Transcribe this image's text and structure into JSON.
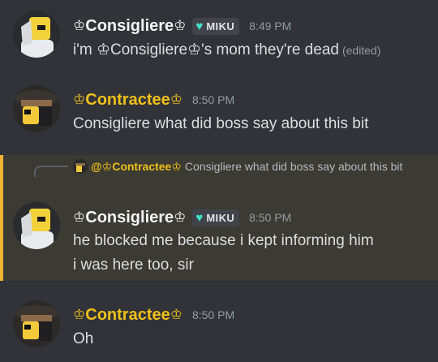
{
  "messages": [
    {
      "author": "Consigliere",
      "crown": "♔",
      "tag": "MIKU",
      "tag_icon": "heart-icon",
      "time": "8:49 PM",
      "text": "i'm ♔Consigliere♔'s mom they're dead",
      "edited": "(edited)"
    },
    {
      "author": "Contractee",
      "crown": "♔",
      "time": "8:50 PM",
      "text": "Consigliere what did boss say about this bit"
    },
    {
      "reply_to": {
        "mention": "@♔Contractee♔",
        "preview": "Consigliere what did boss say about this bit"
      },
      "author": "Consigliere",
      "crown": "♔",
      "tag": "MIKU",
      "tag_icon": "heart-icon",
      "time": "8:50 PM",
      "line1": "he blocked me because i kept informing him",
      "line2": "i was here too, sir"
    },
    {
      "author": "Contractee",
      "crown": "♔",
      "time": "8:50 PM",
      "text": "Oh"
    }
  ],
  "colors": {
    "background": "#313338",
    "highlight": "#3b3a33",
    "highlight_border": "#f0b232",
    "name_yellow": "#f0c01a",
    "tag_heart": "#3fe0c5"
  }
}
